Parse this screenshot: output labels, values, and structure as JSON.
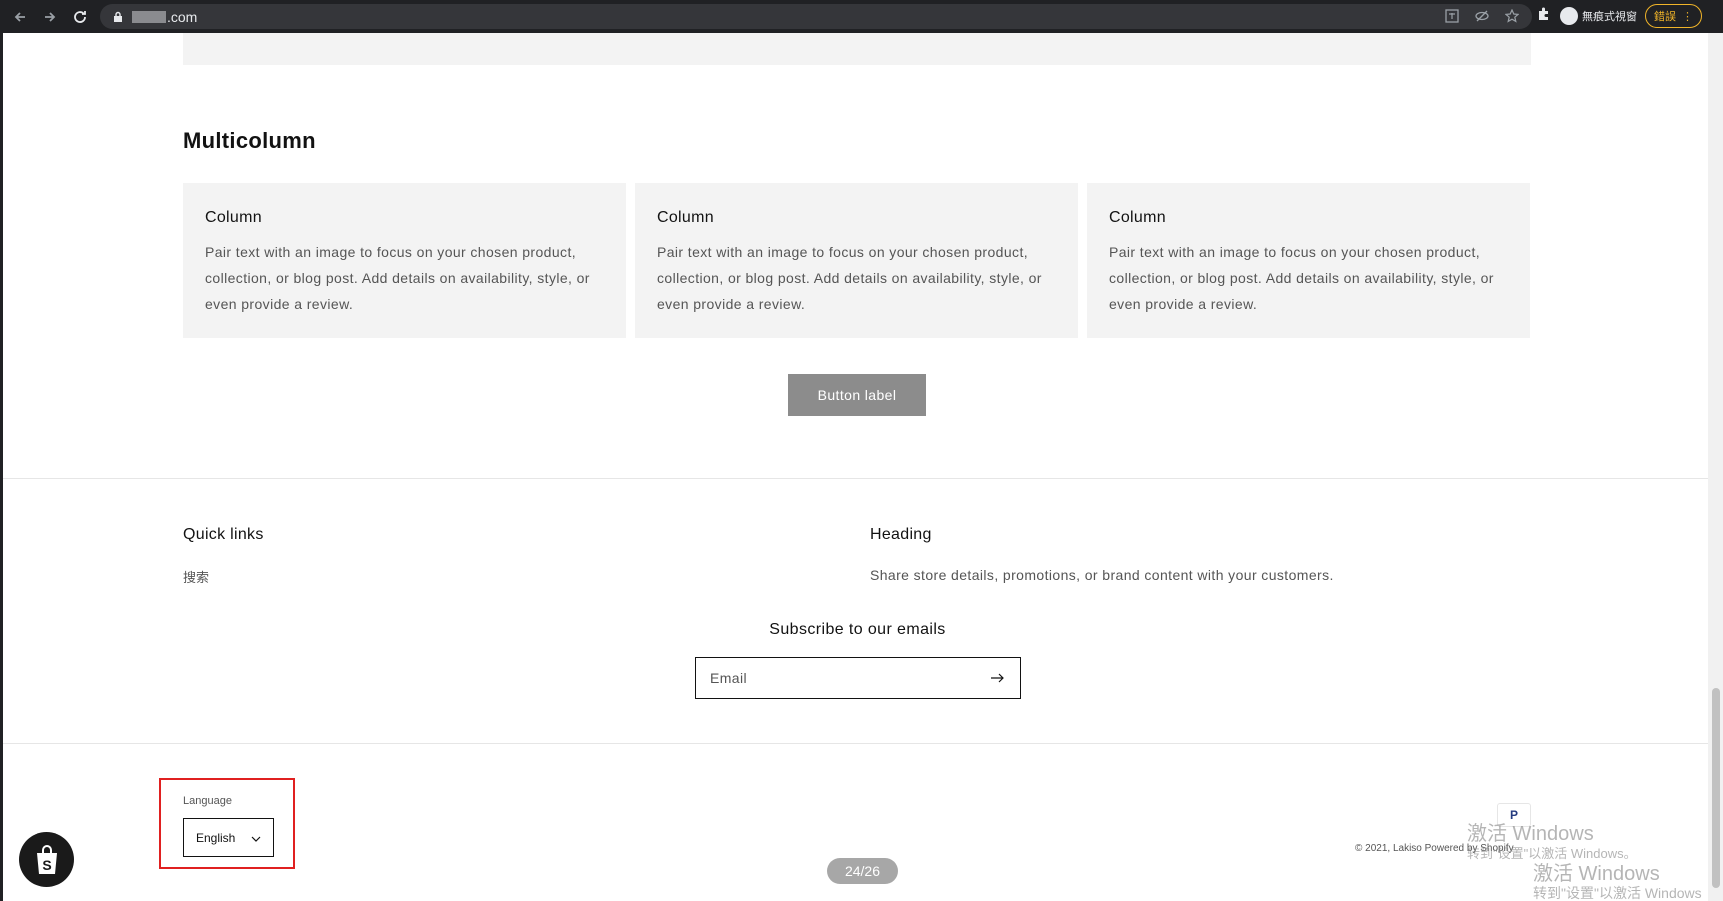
{
  "browser": {
    "url_suffix": ".com",
    "profile_label": "無痕式視窗",
    "error_label": "錯誤"
  },
  "multicolumn": {
    "heading": "Multicolumn",
    "columns": [
      {
        "title": "Column",
        "text": "Pair text with an image to focus on your chosen product, collection, or blog post. Add details on availability, style, or even provide a review."
      },
      {
        "title": "Column",
        "text": "Pair text with an image to focus on your chosen product, collection, or blog post. Add details on availability, style, or even provide a review."
      },
      {
        "title": "Column",
        "text": "Pair text with an image to focus on your chosen product, collection, or blog post. Add details on availability, style, or even provide a review."
      }
    ],
    "button_label": "Button label"
  },
  "footer": {
    "quick_links_heading": "Quick links",
    "quick_links": [
      "搜索"
    ],
    "heading": "Heading",
    "heading_text": "Share store details, promotions, or brand content with your customers.",
    "subscribe_title": "Subscribe to our emails",
    "email_placeholder": "Email",
    "language_label": "Language",
    "language_value": "English",
    "copyright": "© 2021, Lakiso Powered by Shopify"
  },
  "overlay": {
    "page_counter": "24/26",
    "watermark_line1": "激活 Windows",
    "watermark_line2": "转到\"设置\"以激活 Windows。",
    "watermark_line3": "激活 Windows",
    "watermark_line4": "转到\"设置\"以激活 Windows"
  },
  "colors": {
    "highlight_box": "#e02020",
    "button_bg": "#8c8c8c",
    "card_bg": "#f3f3f3"
  }
}
